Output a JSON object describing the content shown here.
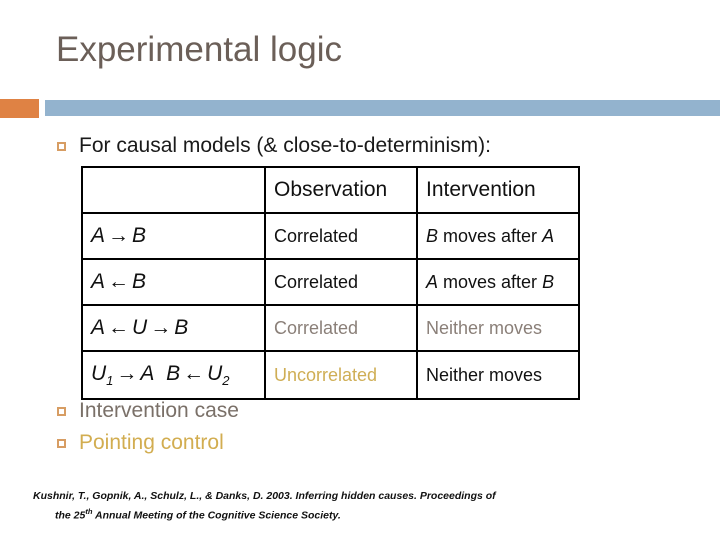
{
  "slide": {
    "title": "Experimental logic",
    "accent_orange": "#df8244",
    "rule_blue": "#93b3ce",
    "title_color": "#6b5f58"
  },
  "bullets": [
    {
      "label": "For causal models (& close-to-determinism):",
      "color": "#1a1a1a"
    },
    {
      "label": "Intervention case",
      "color": "#7a7068"
    },
    {
      "label": "Pointing control",
      "color": "#d2ad50"
    }
  ],
  "table": {
    "headers": [
      "",
      "Observation",
      "Intervention"
    ],
    "rows": [
      {
        "model_a": "A",
        "model_arrow": "→",
        "model_b": "B",
        "observation": "Correlated",
        "observation_color": "#111111",
        "intervention_v1": "B",
        "intervention_mid": " moves after ",
        "intervention_v2": "A",
        "intervention_color": "#111111"
      },
      {
        "model_a": "A",
        "model_arrow": "←",
        "model_b": "B",
        "observation": "Correlated",
        "observation_color": "#111111",
        "intervention_v1": "A",
        "intervention_mid": " moves after ",
        "intervention_v2": "B",
        "intervention_color": "#111111"
      },
      {
        "model_a": "A",
        "model_arrow": "←",
        "model_u": "U",
        "model_arrow2": "→",
        "model_b": "B",
        "observation": "Correlated",
        "observation_color": "#8a7f78",
        "intervention": "Neither moves",
        "intervention_color": "#8a7f78"
      },
      {
        "model_u1": "U",
        "model_u1_sub": "1",
        "model_arrow": "→",
        "model_a": "A",
        "model_b": "B",
        "model_arrow2": "←",
        "model_u2": "U",
        "model_u2_sub": "2",
        "observation": "Uncorrelated",
        "observation_color": "#cfae55",
        "intervention": "Neither moves",
        "intervention_color": "#111111"
      }
    ]
  },
  "citation": {
    "line1": "Kushnir, T., Gopnik, A., Schulz, L., & Danks, D. 2003. Inferring hidden causes. Proceedings of",
    "line2_pre": "the 25",
    "line2_sup": "th",
    "line2_post": " Annual Meeting of the Cognitive Science Society."
  }
}
